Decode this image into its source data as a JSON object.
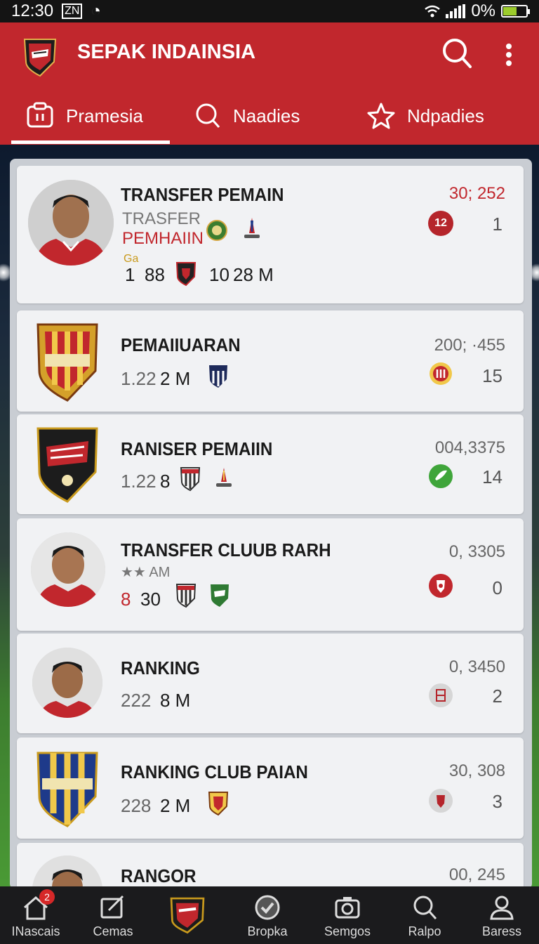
{
  "status_bar": {
    "time": "12:30",
    "battery": "0%"
  },
  "app": {
    "title": "SEPAK INDAINSIA"
  },
  "tabs": [
    {
      "label": "Pramesia",
      "active": true
    },
    {
      "label": "Naadies",
      "active": false
    },
    {
      "label": "Ndpadies",
      "active": false
    }
  ],
  "items": [
    {
      "title": "TRANSFER PEMAIN",
      "subtitle1": "TRASFER",
      "subtitle2": "PEMHAIIN",
      "tag": "Ga",
      "stat_a": "1",
      "stat_b": "88",
      "stat_c": "10",
      "stat_d": "28 M",
      "rank": "30; 252",
      "badge": "12",
      "delta": "1"
    },
    {
      "title": "PEMAIIUARAN",
      "stat_a": "1.22",
      "stat_b": "2 M",
      "rank": "200; ·455",
      "delta": "15"
    },
    {
      "title": "RANISER PEMAIIN",
      "stat_a": "1.22",
      "stat_b": "8",
      "rank": "004,3375",
      "delta": "14"
    },
    {
      "title": "TRANSFER CLUUB RARH",
      "tag": "★★ AM",
      "stat_a": "8",
      "stat_b": "30",
      "rank": "0, 3305",
      "delta": "0"
    },
    {
      "title": "RANKING",
      "stat_a": "222",
      "stat_b": "8 M",
      "rank": "0, 3450",
      "delta": "2"
    },
    {
      "title": "RANKING CLUB PAIAN",
      "stat_a": "228",
      "stat_b": "2 M",
      "rank": "30, 308",
      "delta": "3"
    },
    {
      "title": "RANGOR",
      "rank": "00, 245"
    }
  ],
  "bottom_nav": [
    {
      "label": "INascais",
      "badge": "2",
      "icon": "home-icon"
    },
    {
      "label": "Cemas",
      "icon": "edit-icon"
    },
    {
      "label": "",
      "icon": "club-crest-icon"
    },
    {
      "label": "Bropka",
      "icon": "check-badge-icon"
    },
    {
      "label": "Semgos",
      "icon": "camera-icon"
    },
    {
      "label": "Ralpo",
      "icon": "search-icon"
    },
    {
      "label": "Baress",
      "icon": "person-icon"
    }
  ],
  "colors": {
    "brand": "#c1272d",
    "nav": "#1b1b1d"
  }
}
